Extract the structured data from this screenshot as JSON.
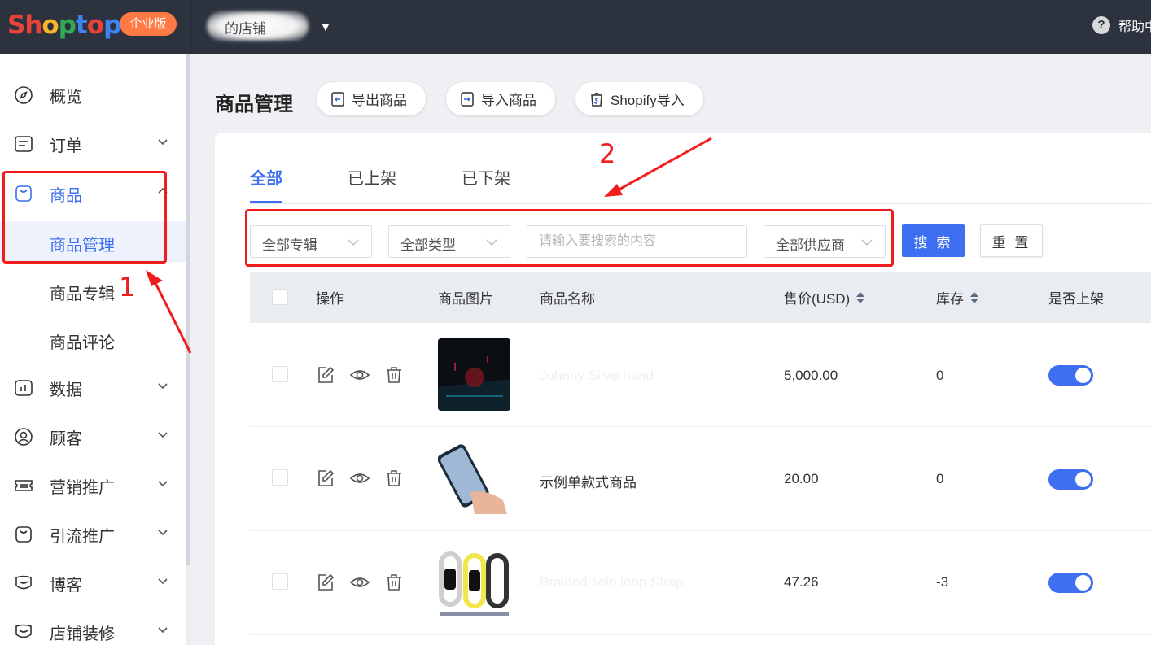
{
  "topbar": {
    "logo_parts": [
      "S",
      "h",
      "o",
      "p",
      "t",
      "o",
      "p"
    ],
    "edition_badge": "企业版",
    "store_name": "的店铺",
    "help_label": "帮助中"
  },
  "sidebar": {
    "items": [
      {
        "label": "概览",
        "icon": "compass-icon"
      },
      {
        "label": "订单",
        "icon": "order-icon"
      },
      {
        "label": "商品",
        "icon": "bag-icon"
      },
      {
        "label": "数据",
        "icon": "chart-icon"
      },
      {
        "label": "顾客",
        "icon": "user-icon"
      },
      {
        "label": "营销推广",
        "icon": "ticket-icon"
      },
      {
        "label": "引流推广",
        "icon": "bag-icon"
      },
      {
        "label": "博客",
        "icon": "blog-icon"
      },
      {
        "label": "店铺装修",
        "icon": "store-icon"
      }
    ],
    "sub_items": [
      {
        "label": "商品管理"
      },
      {
        "label": "商品专辑"
      },
      {
        "label": "商品评论"
      }
    ]
  },
  "annotations": {
    "one": "1",
    "two": "2"
  },
  "header": {
    "title": "商品管理",
    "actions": [
      {
        "label": "导出商品",
        "icon": "export-icon"
      },
      {
        "label": "导入商品",
        "icon": "import-icon"
      },
      {
        "label": "Shopify导入",
        "icon": "shopify-icon"
      }
    ]
  },
  "tabs": [
    {
      "label": "全部"
    },
    {
      "label": "已上架"
    },
    {
      "label": "已下架"
    }
  ],
  "filters": {
    "collection": "全部专辑",
    "type": "全部类型",
    "search_placeholder": "请输入要搜索的内容",
    "supplier": "全部供应商",
    "search_button": "搜 索",
    "reset_button": "重 置"
  },
  "table": {
    "columns": [
      "操作",
      "商品图片",
      "商品名称",
      "售价(USD)",
      "库存",
      "是否上架"
    ],
    "rows": [
      {
        "name": "Johnny Silverhand",
        "price": "5,000.00",
        "stock": "0",
        "listed": true
      },
      {
        "name": "示例单款式商品",
        "price": "20.00",
        "stock": "0",
        "listed": true
      },
      {
        "name": "Braided solo loop Strap",
        "price": "47.26",
        "stock": "-3",
        "listed": true
      }
    ]
  },
  "colors": {
    "accent": "#3d6ff0",
    "topbar": "#2c333f",
    "annotation": "#ef1d1d",
    "badge": "#ff7a45"
  }
}
